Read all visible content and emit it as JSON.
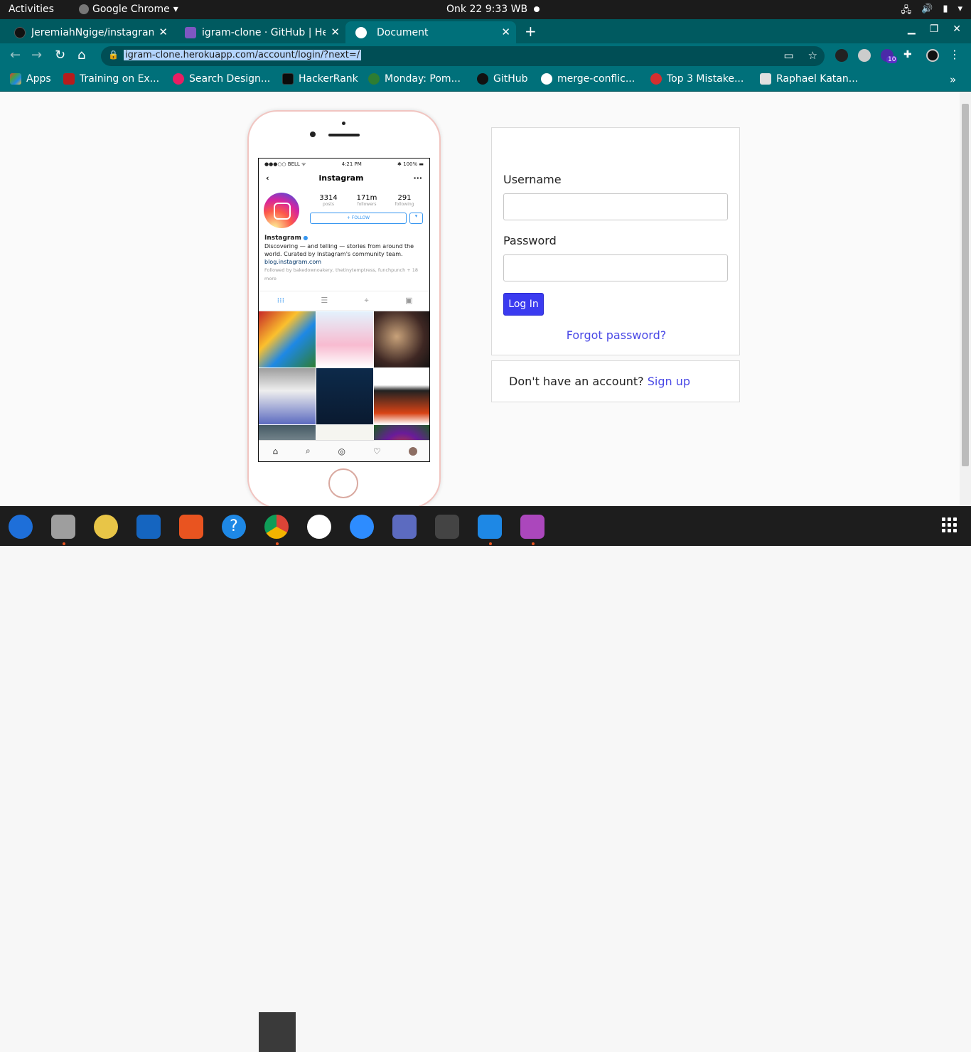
{
  "system": {
    "activities": "Activities",
    "app_name": "Google Chrome",
    "clock": "Onk 22  9:33 WB"
  },
  "tabs": [
    {
      "label": "JeremiahNgige/instagram",
      "icon": "github-icon"
    },
    {
      "label": "igram-clone · GitHub | Her",
      "icon": "heroku-icon"
    },
    {
      "label": "Document",
      "icon": "globe-icon"
    }
  ],
  "window": {
    "new_tab": "+"
  },
  "omnibox": {
    "url": "igram-clone.herokuapp.com/account/login/?next=/"
  },
  "extensions": {
    "badge": "10"
  },
  "bookmarks": [
    {
      "label": "Apps",
      "color": "#e53935"
    },
    {
      "label": "Training on Ex...",
      "color": "#b71c1c"
    },
    {
      "label": "Search Design...",
      "color": "#e91e63"
    },
    {
      "label": "HackerRank",
      "color": "#0b0b0b"
    },
    {
      "label": "Monday: Pom...",
      "color": "#2e7d32"
    },
    {
      "label": "GitHub",
      "color": "#111111"
    },
    {
      "label": "merge-conflic...",
      "color": "#ffffff"
    },
    {
      "label": "Top 3 Mistake...",
      "color": "#d32f2f"
    },
    {
      "label": "Raphael Katan...",
      "color": "#e0e0e0"
    }
  ],
  "phone": {
    "carrier": "●●●○○ BELL ᯤ",
    "time": "4:21 PM",
    "battery": "✱ 100% ▬",
    "username": "instagram",
    "stats": [
      {
        "n": "3314",
        "l": "posts"
      },
      {
        "n": "171m",
        "l": "followers"
      },
      {
        "n": "291",
        "l": "following"
      }
    ],
    "follow": "+ FOLLOW",
    "name": "Instagram",
    "bio": "Discovering — and telling — stories from around the world. Curated by Instagram's community team.",
    "link": "blog.instagram.com",
    "followed_by": "Followed by bakedownoakery, thetinytemptress, funchpunch + 18 more"
  },
  "login": {
    "username_label": "Username",
    "password_label": "Password",
    "button": "Log In",
    "forgot": "Forgot password?"
  },
  "signup": {
    "prompt": "Don't have an account?",
    "link": "Sign up"
  },
  "dock": [
    {
      "name": "thunderbird",
      "color": "#1e6fd9",
      "running": false
    },
    {
      "name": "files",
      "color": "#9e9e9e",
      "running": true
    },
    {
      "name": "rhythmbox",
      "color": "#e8c547",
      "running": false
    },
    {
      "name": "libreoffice-writer",
      "color": "#1565c0",
      "running": false
    },
    {
      "name": "software-center",
      "color": "#e95420",
      "running": false
    },
    {
      "name": "help",
      "color": "#1e88e5",
      "running": false
    },
    {
      "name": "chrome",
      "color": "#4caf50",
      "running": true
    },
    {
      "name": "slack",
      "color": "#ffffff",
      "running": false
    },
    {
      "name": "zoom",
      "color": "#2d8cff",
      "running": false
    },
    {
      "name": "screenshot",
      "color": "#5c6bc0",
      "running": false
    },
    {
      "name": "system-monitor",
      "color": "#444444",
      "running": false
    },
    {
      "name": "vscode",
      "color": "#1e88e5",
      "running": true
    },
    {
      "name": "video",
      "color": "#ab47bc",
      "running": true
    }
  ]
}
